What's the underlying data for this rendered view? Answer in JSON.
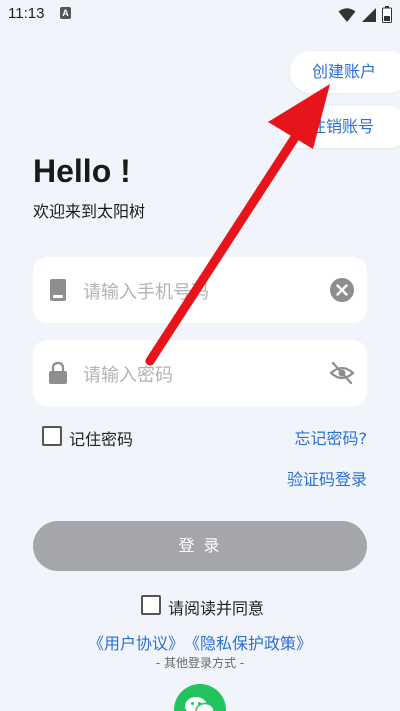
{
  "status_bar": {
    "time": "11:13",
    "notification_badge": "A",
    "icons": [
      "wifi-icon",
      "signal-icon",
      "battery-icon"
    ]
  },
  "header_actions": {
    "create_account": "创建账户",
    "cancel_account": "注销账号"
  },
  "greeting": {
    "title": "Hello !",
    "subtitle": "欢迎来到太阳树"
  },
  "form": {
    "phone_placeholder": "请输入手机号码",
    "password_placeholder": "请输入密码",
    "remember_password": "记住密码",
    "forgot_password": "忘记密码?",
    "sms_login": "验证码登录",
    "login_button": "登 录"
  },
  "agreement": {
    "label": "请阅读并同意",
    "user_agreement": "《用户协议》",
    "privacy_policy": "《隐私保护政策》"
  },
  "other_login": {
    "label": "- 其他登录方式 -",
    "providers": [
      "wechat-icon"
    ]
  },
  "colors": {
    "background": "#f1f5fb",
    "accent": "#2d6fd8",
    "login_disabled": "#a5a6a9",
    "annotation_arrow": "#e8141b",
    "wechat": "#22c35e"
  }
}
